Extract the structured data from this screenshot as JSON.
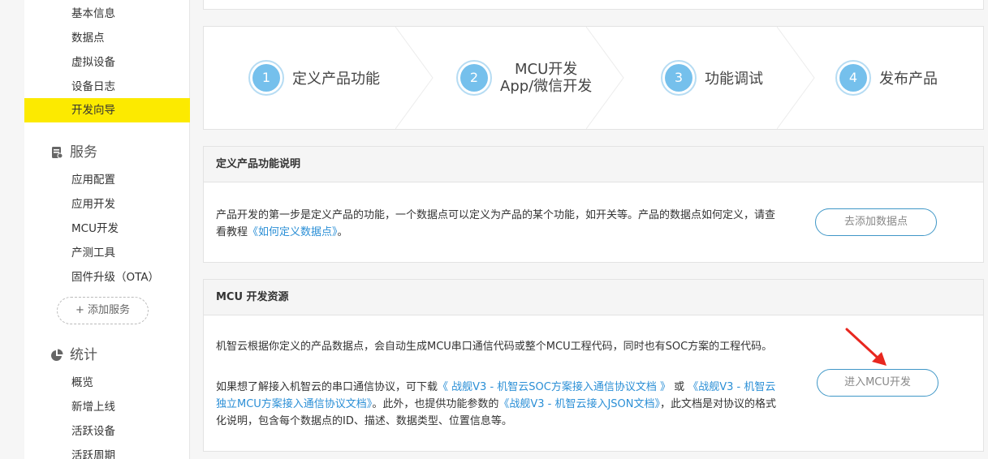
{
  "sidebar": {
    "items_top": [
      "基本信息",
      "数据点",
      "虚拟设备",
      "设备日志",
      "开发向导"
    ],
    "active_item": "开发向导",
    "service_section": "服务",
    "service_items": [
      "应用配置",
      "应用开发",
      "MCU开发",
      "产测工具",
      "固件升级（OTA）"
    ],
    "add_service": "+ 添加服务",
    "stats_section": "统计",
    "stats_items": [
      "概览",
      "新增上线",
      "活跃设备",
      "活跃周期"
    ]
  },
  "steps": [
    {
      "num": "1",
      "label": "定义产品功能"
    },
    {
      "num": "2",
      "line1": "MCU开发",
      "line2": "App/微信开发"
    },
    {
      "num": "3",
      "label": "功能调试"
    },
    {
      "num": "4",
      "label": "发布产品"
    }
  ],
  "panel_define": {
    "title": "定义产品功能说明",
    "text_before": "产品开发的第一步是定义产品的功能，一个数据点可以定义为产品的某个功能，如开关等。产品的数据点如何定义，请查看教程",
    "link": "《如何定义数据点》",
    "text_after": "。",
    "button": "去添加数据点"
  },
  "panel_mcu": {
    "title": "MCU 开发资源",
    "para1": "机智云根据你定义的产品数据点，会自动生成MCU串口通信代码或整个MCU工程代码，同时也有SOC方案的工程代码。",
    "p2_a": "如果想了解接入机智云的串口通信协议，可下载",
    "p2_link1": "《 战舰V3 - 机智云SOC方案接入通信协议文档 》",
    "p2_b": " 或 ",
    "p2_link2": "《战舰V3 - 机智云独立MCU方案接入通信协议文档》",
    "p2_c": "。此外，也提供功能参数的",
    "p2_link3": "《战舰V3 - 机智云接入JSON文档》",
    "p2_d": "，此文档是对协议的格式化说明，包含每个数据点的ID、描述、数据类型、位置信息等。",
    "button": "进入MCU开发"
  },
  "colors": {
    "accent": "#fcea00",
    "step_circle": "#75c0ec",
    "link": "#2b8fd6",
    "arrow": "#e8271f"
  }
}
